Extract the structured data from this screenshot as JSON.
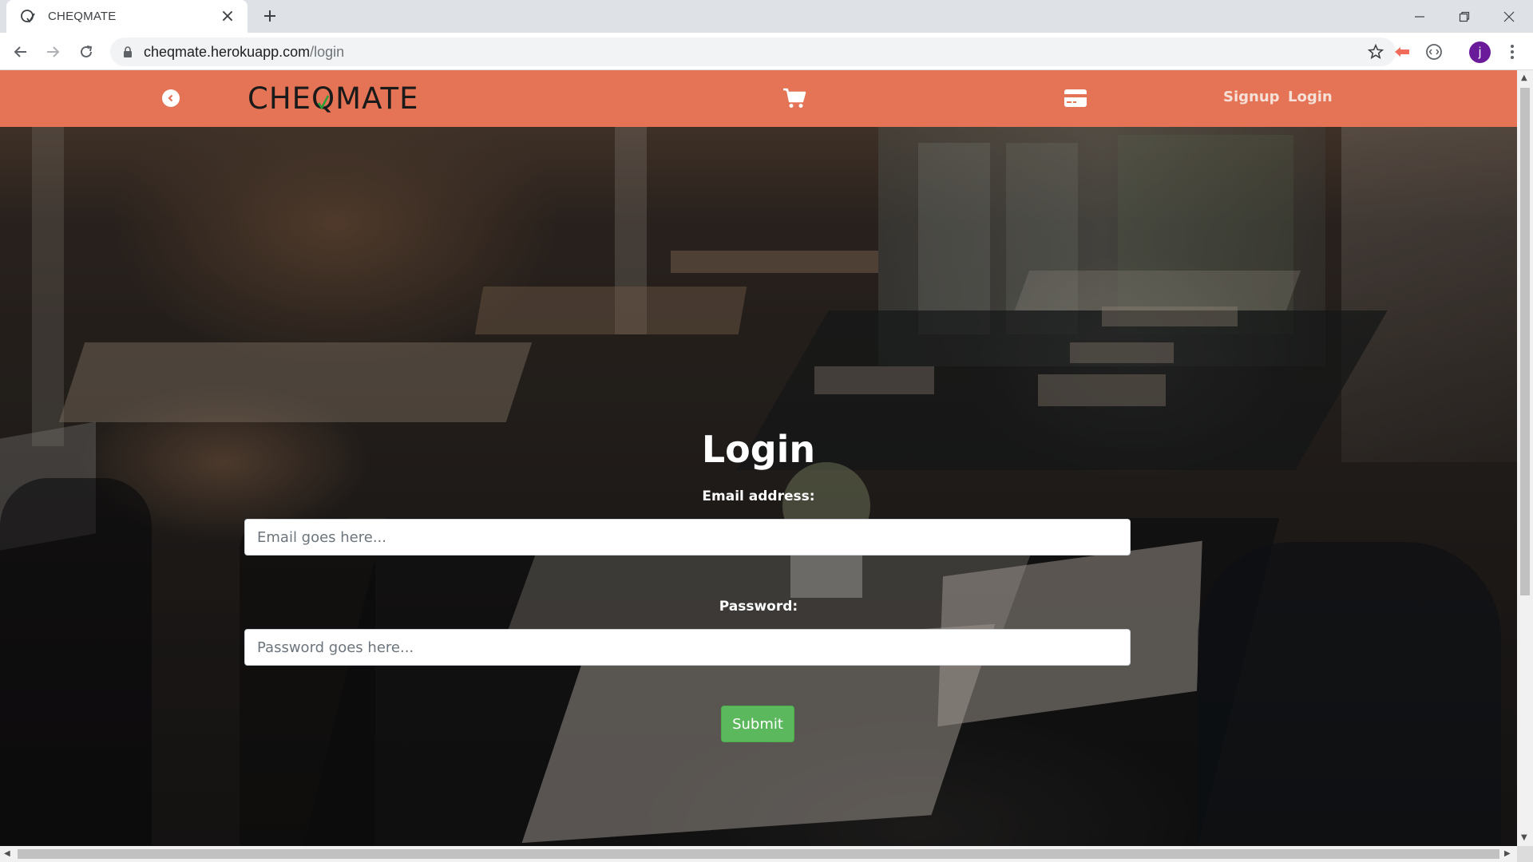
{
  "browser": {
    "tab_title": "CHEQMATE",
    "new_tab_icon": "plus-icon",
    "url_host": "cheqmate.herokuapp.com",
    "url_path": "/login",
    "profile_initial": "j"
  },
  "navbar": {
    "logo_left": "CHEQ",
    "logo_right": "MATE",
    "signup_label": "Signup",
    "login_label": "Login",
    "color": "#e57356",
    "icons": [
      "chevron-circle-left-icon",
      "shopping-cart-icon",
      "credit-card-icon"
    ]
  },
  "form": {
    "title": "Login",
    "email_label": "Email address:",
    "email_placeholder": "Email goes here...",
    "password_label": "Password:",
    "password_placeholder": "Password goes here...",
    "submit_label": "Submit",
    "submit_color": "#5cb85c"
  }
}
